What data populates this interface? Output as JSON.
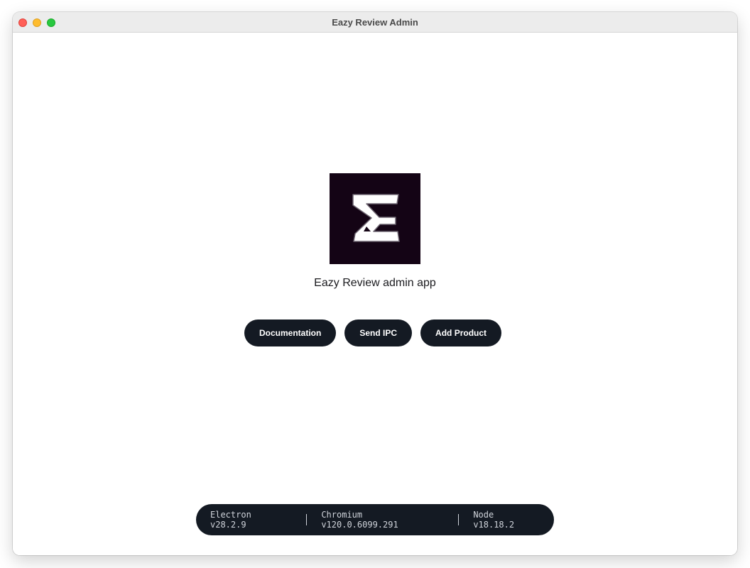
{
  "window": {
    "title": "Eazy Review Admin"
  },
  "main": {
    "logo_icon": "eazy-review-logo-icon",
    "app_title": "Eazy Review admin app",
    "buttons": [
      {
        "label": "Documentation"
      },
      {
        "label": "Send IPC"
      },
      {
        "label": "Add Product"
      }
    ]
  },
  "versions": {
    "electron": "Electron v28.2.9",
    "chromium": "Chromium v120.0.6099.291",
    "node": "Node v18.18.2"
  },
  "colors": {
    "button_bg": "#141a23",
    "logo_bg": "#140415",
    "close": "#ff5f57",
    "minimize": "#febc2e",
    "maximize": "#28c840"
  }
}
